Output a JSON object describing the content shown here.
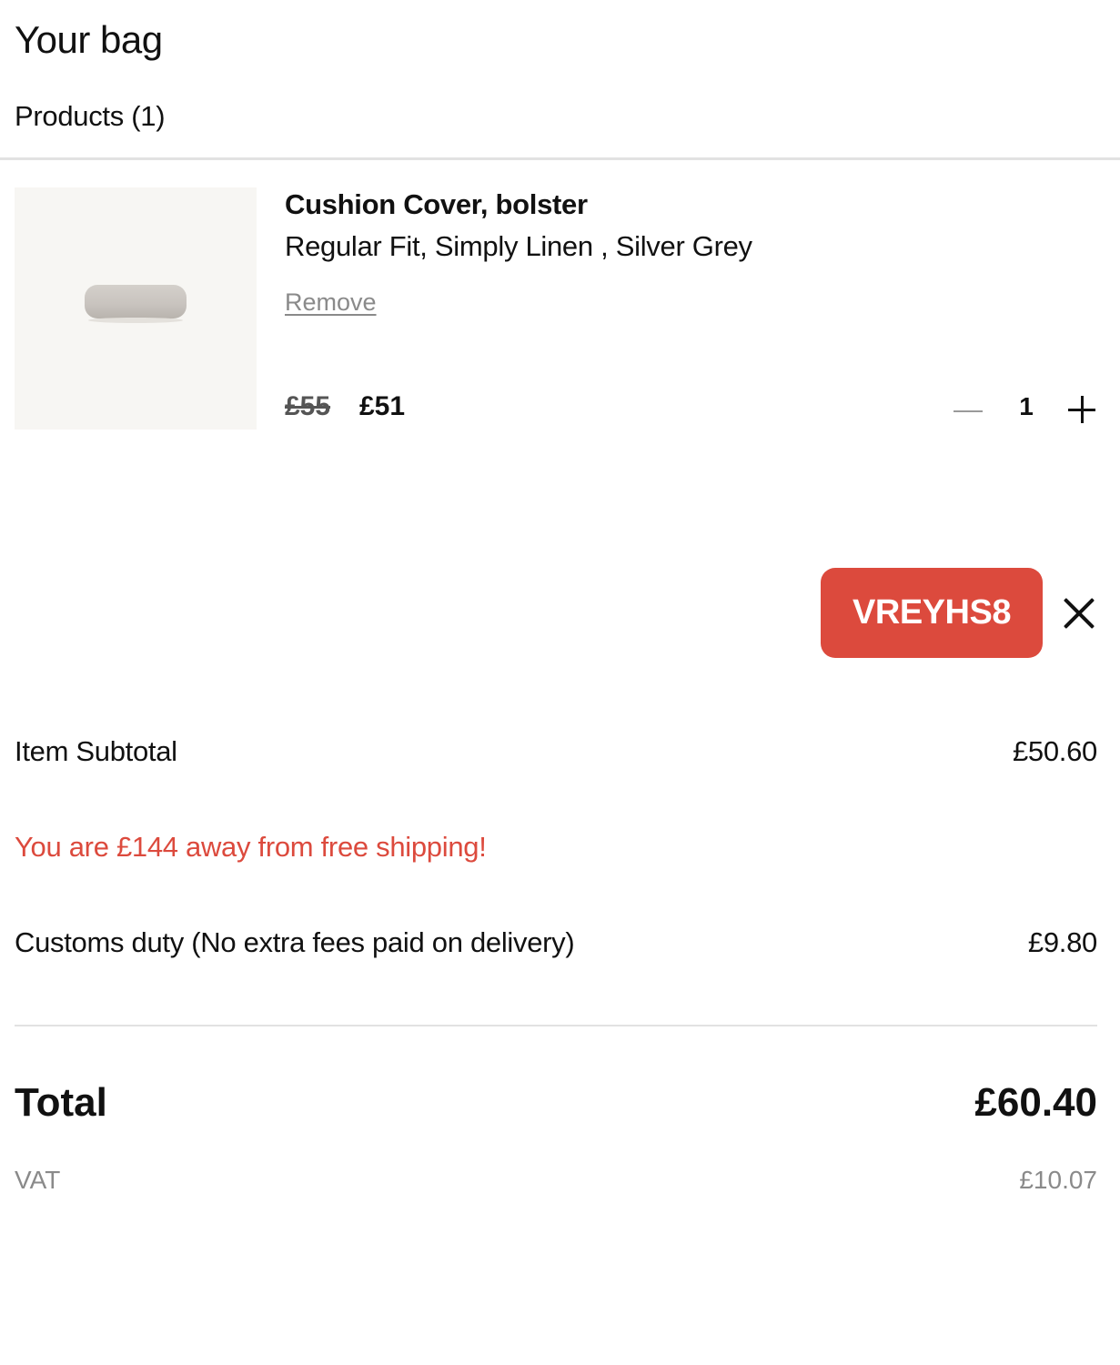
{
  "header": {
    "title": "Your bag",
    "products_count_label": "Products (1)"
  },
  "cart": {
    "items": [
      {
        "name": "Cushion Cover, bolster",
        "variant": "Regular Fit, Simply Linen , Silver Grey",
        "remove_label": "Remove",
        "original_price": "£55",
        "sale_price": "£51",
        "quantity": "1",
        "image_icon": "bolster-cushion-image"
      }
    ]
  },
  "promo": {
    "code": "VREYHS8",
    "badge_color": "#dc4a3d",
    "remove_icon": "close-icon"
  },
  "summary": {
    "subtotal_label": "Item Subtotal",
    "subtotal_value": "£50.60",
    "shipping_message": "You are £144 away from free shipping!",
    "shipping_message_color": "#dc4a3d",
    "customs_label": "Customs duty (No extra fees paid on delivery)",
    "customs_value": "£9.80",
    "total_label": "Total",
    "total_value": "£60.40",
    "vat_label": "VAT",
    "vat_value": "£10.07"
  }
}
